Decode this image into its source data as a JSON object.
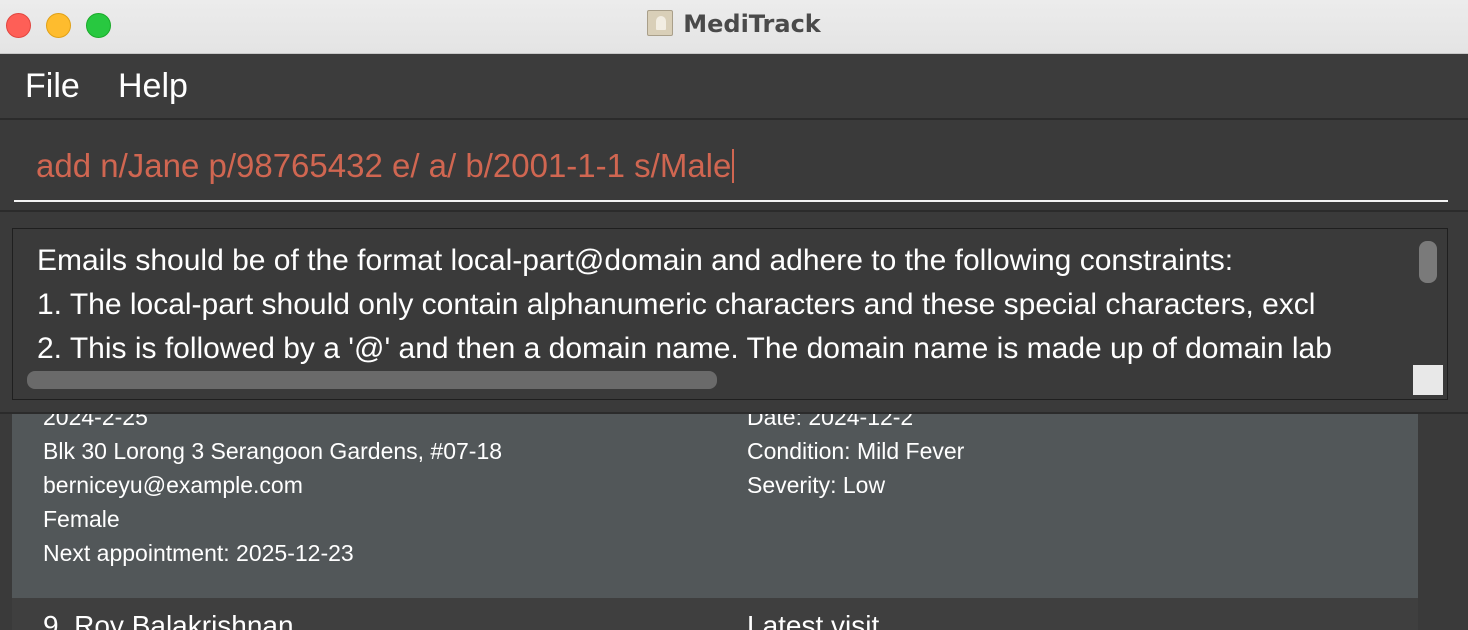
{
  "window": {
    "title": "MediTrack"
  },
  "menu": {
    "file": "File",
    "help": "Help"
  },
  "command": {
    "value": "add n/Jane p/98765432 e/ a/ b/2001-1-1 s/Male"
  },
  "result": {
    "lines": [
      "Emails should be of the format local-part@domain and adhere to the following constraints:",
      "1. The local-part should only contain alphanumeric characters and these special characters, excl",
      "2. This is followed by a '@' and then a domain name. The domain name is made up of domain lab"
    ]
  },
  "person_list": {
    "selected": {
      "left": [
        "2024-2-25",
        "Blk 30 Lorong 3 Serangoon Gardens, #07-18",
        "berniceyu@example.com",
        "Female",
        "Next appointment: 2025-12-23"
      ],
      "right": [
        "Date: 2024-12-2",
        "Condition: Mild Fever",
        "Severity: Low"
      ]
    },
    "next": {
      "name": "9.  Roy Balakrishnan",
      "right": "Latest visit"
    }
  }
}
